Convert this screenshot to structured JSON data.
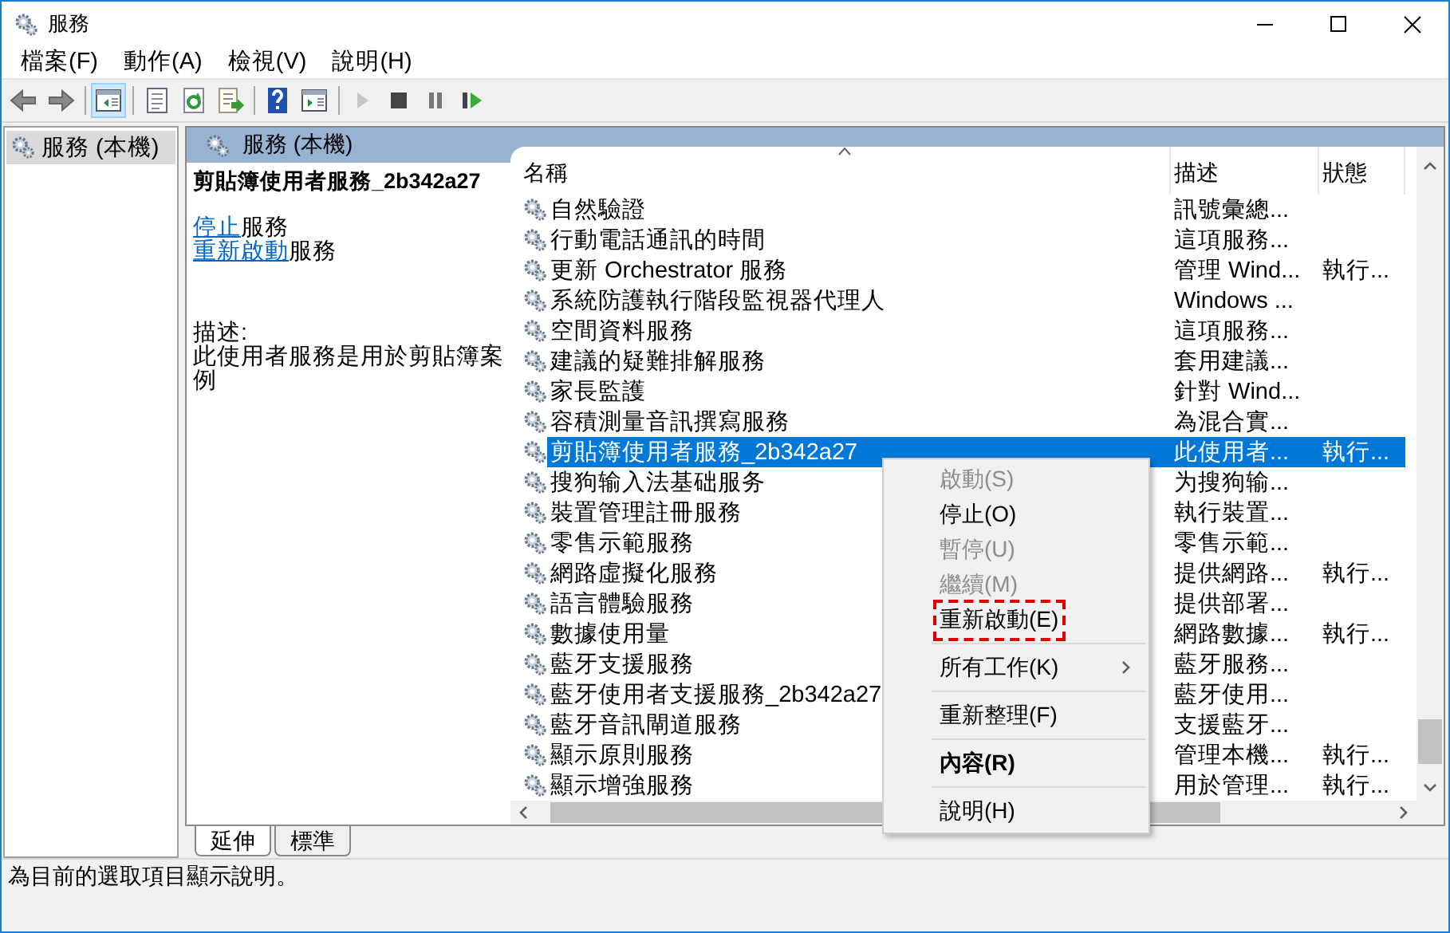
{
  "window": {
    "title": "服務"
  },
  "menu_bar": [
    "檔案(F)",
    "動作(A)",
    "檢視(V)",
    "說明(H)"
  ],
  "toolbar": [
    {
      "kind": "back",
      "pressed": false,
      "disabled": false
    },
    {
      "kind": "forward",
      "pressed": false,
      "disabled": false
    },
    {
      "kind": "separator"
    },
    {
      "kind": "tree",
      "pressed": true,
      "disabled": false
    },
    {
      "kind": "separator"
    },
    {
      "kind": "properties",
      "pressed": false,
      "disabled": false
    },
    {
      "kind": "refresh",
      "pressed": false,
      "disabled": false
    },
    {
      "kind": "export",
      "pressed": false,
      "disabled": false
    },
    {
      "kind": "separator"
    },
    {
      "kind": "help",
      "pressed": false,
      "disabled": false
    },
    {
      "kind": "view",
      "pressed": false,
      "disabled": false
    },
    {
      "kind": "separator"
    },
    {
      "kind": "play",
      "pressed": false,
      "disabled": true
    },
    {
      "kind": "stop",
      "pressed": false,
      "disabled": false
    },
    {
      "kind": "pause",
      "pressed": false,
      "disabled": false
    },
    {
      "kind": "resume",
      "pressed": false,
      "disabled": false
    }
  ],
  "tree": {
    "items": [
      {
        "label": "服務 (本機)",
        "selected": true
      }
    ]
  },
  "pane_header": "服務 (本機)",
  "details": {
    "title": "剪貼簿使用者服務_2b342a27",
    "actions": [
      {
        "link": "停止",
        "text": "服務"
      },
      {
        "link": "重新啟動",
        "text": "服務"
      }
    ],
    "description_label": "描述:",
    "description": "此使用者服務是用於剪貼簿案例"
  },
  "table": {
    "columns": [
      {
        "label": "名稱",
        "sorted": true
      },
      {
        "label": "描述",
        "sorted": false
      },
      {
        "label": "狀態",
        "sorted": false
      }
    ],
    "rows": [
      {
        "name": "自然驗證",
        "description": "訊號彙總...",
        "selected": false
      },
      {
        "name": "行動電話通訊的時間",
        "description": "這項服務...",
        "selected": false
      },
      {
        "name": "更新 Orchestrator 服務",
        "description": "管理 Wind...",
        "status": "執行...",
        "selected": false
      },
      {
        "name": "系統防護執行階段監視器代理人",
        "description": "Windows ...",
        "selected": false
      },
      {
        "name": "空間資料服務",
        "description": "這項服務...",
        "selected": false
      },
      {
        "name": "建議的疑難排解服務",
        "description": "套用建議...",
        "selected": false
      },
      {
        "name": "家長監護",
        "description": "針對 Wind...",
        "selected": false
      },
      {
        "name": "容積測量音訊撰寫服務",
        "description": "為混合實...",
        "selected": false
      },
      {
        "name": "剪貼簿使用者服務_2b342a27",
        "description": "此使用者...",
        "status": "執行...",
        "selected": true
      },
      {
        "name": "搜狗输入法基础服务",
        "description": "为搜狗输...",
        "selected": false
      },
      {
        "name": "裝置管理註冊服務",
        "description": "執行裝置...",
        "selected": false
      },
      {
        "name": "零售示範服務",
        "description": "零售示範...",
        "selected": false
      },
      {
        "name": "網路虛擬化服務",
        "description": "提供網路...",
        "status": "執行...",
        "selected": false
      },
      {
        "name": "語言體驗服務",
        "description": "提供部署...",
        "selected": false
      },
      {
        "name": "數據使用量",
        "description": "網路數據...",
        "status": "執行...",
        "selected": false
      },
      {
        "name": "藍牙支援服務",
        "description": "藍牙服務...",
        "selected": false
      },
      {
        "name": "藍牙使用者支援服務_2b342a27",
        "description": "藍牙使用...",
        "selected": false
      },
      {
        "name": "藍牙音訊閘道服務",
        "description": "支援藍牙...",
        "selected": false
      },
      {
        "name": "顯示原則服務",
        "description": "管理本機...",
        "status": "執行...",
        "selected": false
      },
      {
        "name": "顯示增強服務",
        "description": "用於管理...",
        "status": "執行...",
        "selected": false
      }
    ]
  },
  "context_menu": {
    "items": [
      {
        "kind": "item",
        "label": "啟動(S)",
        "disabled": true,
        "default": false,
        "submenu": false,
        "annotated": false
      },
      {
        "kind": "item",
        "label": "停止(O)",
        "disabled": false,
        "default": false,
        "submenu": false,
        "annotated": false
      },
      {
        "kind": "item",
        "label": "暫停(U)",
        "disabled": true,
        "default": false,
        "submenu": false,
        "annotated": false
      },
      {
        "kind": "item",
        "label": "繼續(M)",
        "disabled": true,
        "default": false,
        "submenu": false,
        "annotated": false
      },
      {
        "kind": "item",
        "label": "重新啟動(E)",
        "disabled": false,
        "default": false,
        "submenu": false,
        "annotated": true
      },
      {
        "kind": "separator"
      },
      {
        "kind": "item",
        "label": "所有工作(K)",
        "disabled": false,
        "default": false,
        "submenu": true,
        "annotated": false
      },
      {
        "kind": "separator"
      },
      {
        "kind": "item",
        "label": "重新整理(F)",
        "disabled": false,
        "default": false,
        "submenu": false,
        "annotated": false
      },
      {
        "kind": "separator"
      },
      {
        "kind": "item",
        "label": "內容(R)",
        "disabled": false,
        "default": true,
        "submenu": false,
        "annotated": false
      },
      {
        "kind": "separator"
      },
      {
        "kind": "item",
        "label": "說明(H)",
        "disabled": false,
        "default": false,
        "submenu": false,
        "annotated": false
      }
    ]
  },
  "bottom_tabs": [
    {
      "label": "延伸",
      "selected": true
    },
    {
      "label": "標準",
      "selected": false
    }
  ],
  "status_bar": "為目前的選取項目顯示說明。"
}
